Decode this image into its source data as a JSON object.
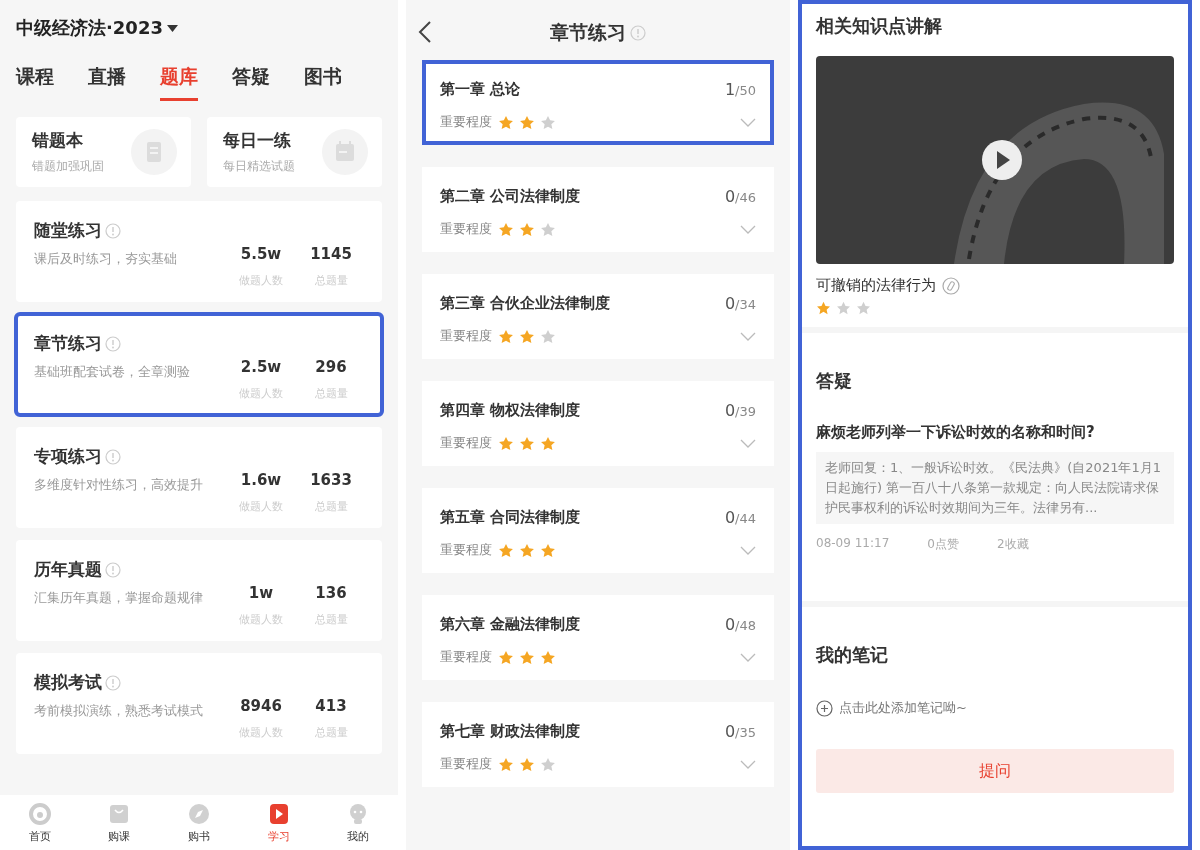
{
  "course_screen": {
    "course_selector": "中级经济法·2023",
    "tabs": [
      {
        "label": "课程",
        "selected": false
      },
      {
        "label": "直播",
        "selected": false
      },
      {
        "label": "题库",
        "selected": true
      },
      {
        "label": "答疑",
        "selected": false
      },
      {
        "label": "图书",
        "selected": false
      }
    ],
    "quick_cards": [
      {
        "kind": "notebook",
        "title": "错题本",
        "subtitle": "错题加强巩固"
      },
      {
        "kind": "calendar",
        "title": "每日一练",
        "subtitle": "每日精选试题"
      }
    ],
    "practice_cards": [
      {
        "title": "随堂练习",
        "description": "课后及时练习，夯实基础",
        "users": "5.5w",
        "users_label": "做题人数",
        "questions": "1145",
        "questions_label": "总题量",
        "highlighted": false
      },
      {
        "title": "章节练习",
        "description": "基础班配套试卷，全章测验",
        "users": "2.5w",
        "users_label": "做题人数",
        "questions": "296",
        "questions_label": "总题量",
        "highlighted": true
      },
      {
        "title": "专项练习",
        "description": "多维度针对性练习，高效提升",
        "users": "1.6w",
        "users_label": "做题人数",
        "questions": "1633",
        "questions_label": "总题量",
        "highlighted": false
      },
      {
        "title": "历年真题",
        "description": "汇集历年真题，掌握命题规律",
        "users": "1w",
        "users_label": "做题人数",
        "questions": "136",
        "questions_label": "总题量",
        "highlighted": false
      },
      {
        "title": "模拟考试",
        "description": "考前模拟演练，熟悉考试模式",
        "users": "8946",
        "users_label": "做题人数",
        "questions": "413",
        "questions_label": "总题量",
        "highlighted": false
      }
    ],
    "bottom_nav": [
      {
        "kind": "home",
        "label": "首页",
        "selected": false
      },
      {
        "kind": "bag",
        "label": "购课",
        "selected": false
      },
      {
        "kind": "compass",
        "label": "购书",
        "selected": false
      },
      {
        "kind": "play",
        "label": "学习",
        "selected": true
      },
      {
        "kind": "person",
        "label": "我的",
        "selected": false
      }
    ]
  },
  "chapter_screen": {
    "title": "章节练习",
    "chapters": [
      {
        "title": "第一章 总论",
        "done": "1",
        "total": "/50",
        "importance_label": "重要程度",
        "stars": 2,
        "highlighted": true
      },
      {
        "title": "第二章 公司法律制度",
        "done": "0",
        "total": "/46",
        "importance_label": "重要程度",
        "stars": 2,
        "highlighted": false
      },
      {
        "title": "第三章 合伙企业法律制度",
        "done": "0",
        "total": "/34",
        "importance_label": "重要程度",
        "stars": 2,
        "highlighted": false
      },
      {
        "title": "第四章 物权法律制度",
        "done": "0",
        "total": "/39",
        "importance_label": "重要程度",
        "stars": 3,
        "highlighted": false
      },
      {
        "title": "第五章 合同法律制度",
        "done": "0",
        "total": "/44",
        "importance_label": "重要程度",
        "stars": 3,
        "highlighted": false
      },
      {
        "title": "第六章 金融法律制度",
        "done": "0",
        "total": "/48",
        "importance_label": "重要程度",
        "stars": 3,
        "highlighted": false
      },
      {
        "title": "第七章 财政法律制度",
        "done": "0",
        "total": "/35",
        "importance_label": "重要程度",
        "stars": 2,
        "highlighted": false
      }
    ]
  },
  "detail_screen": {
    "highlighted": true,
    "knowledge_heading": "相关知识点讲解",
    "knowledge_point": {
      "title": "可撤销的法律行为",
      "stars": 1
    },
    "qa_heading": "答疑",
    "question": {
      "title": "麻烦老师列举一下诉讼时效的名称和时间?",
      "answer": "老师回复：1、一般诉讼时效。《民法典》(自2021年1月1日起施行) 第一百八十八条第一款规定：向人民法院请求保护民事权利的诉讼时效期间为三年。法律另有...",
      "date": "08-09 11:17",
      "likes": "0点赞",
      "favorites": "2收藏"
    },
    "notes_heading": "我的笔记",
    "add_note": "点击此处添加笔记呦~",
    "ask_button": "提问"
  }
}
